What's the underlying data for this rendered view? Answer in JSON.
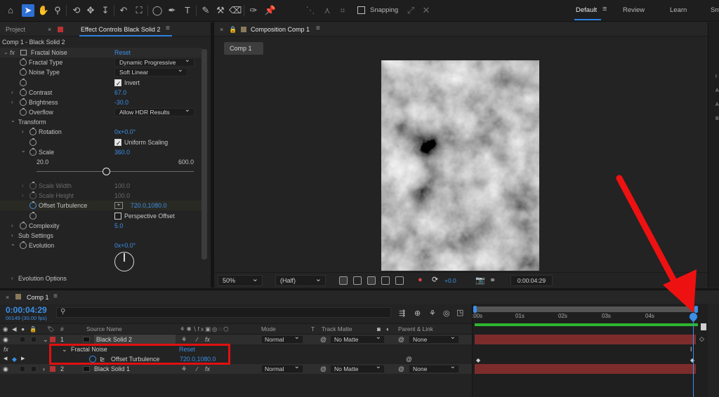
{
  "toolbar": {
    "snapping_label": "Snapping",
    "workspaces": [
      "Default",
      "Review",
      "Learn",
      "Sm"
    ],
    "active_workspace": "Default"
  },
  "project_tab": "Project",
  "effect_controls": {
    "tab_label": "Effect Controls Black Solid 2",
    "breadcrumb": "Comp 1 - Black Solid 2",
    "effect_name": "Fractal Noise",
    "reset": "Reset",
    "properties": {
      "fractal_type_label": "Fractal Type",
      "fractal_type_value": "Dynamic Progressive",
      "noise_type_label": "Noise Type",
      "noise_type_value": "Soft Linear",
      "invert_label": "Invert",
      "contrast_label": "Contrast",
      "contrast_value": "67.0",
      "brightness_label": "Brightness",
      "brightness_value": "-30.0",
      "overflow_label": "Overflow",
      "overflow_value": "Allow HDR Results",
      "transform_label": "Transform",
      "rotation_label": "Rotation",
      "rotation_value": "0x+0.0°",
      "uniform_scaling_label": "Uniform Scaling",
      "scale_label": "Scale",
      "scale_value": "360.0",
      "scale_min": "20.0",
      "scale_max": "600.0",
      "scale_slider_level": 0.44,
      "scale_width_label": "Scale Width",
      "scale_width_value": "100.0",
      "scale_height_label": "Scale Height",
      "scale_height_value": "100.0",
      "offset_turbulence_label": "Offset Turbulence",
      "offset_turbulence_value": "720.0,1080.0",
      "perspective_offset_label": "Perspective Offset",
      "complexity_label": "Complexity",
      "complexity_value": "5.0",
      "sub_settings_label": "Sub Settings",
      "evolution_label": "Evolution",
      "evolution_value": "0x+0.0°",
      "evolution_options_label": "Evolution Options"
    }
  },
  "composition": {
    "tab_label": "Composition Comp 1",
    "comp_button": "Comp 1",
    "zoom": "50%",
    "resolution": "(Half)",
    "exposure": "+0.0",
    "timecode": "0:00:04:29"
  },
  "timeline": {
    "tab_label": "Comp 1",
    "timecode": "0:00:04:29",
    "frame_info": "00149 (30.00 fps)",
    "search_placeholder": "",
    "columns": {
      "hash": "#",
      "source_name": "Source Name",
      "mode": "Mode",
      "t": "T",
      "track_matte": "Track Matte",
      "parent_link": "Parent & Link"
    },
    "ruler_labels": [
      ":00s",
      "01s",
      "02s",
      "03s",
      "04s"
    ],
    "layers": [
      {
        "num": "1",
        "name": "Black Solid 2",
        "mode": "Normal",
        "matte": "No Matte",
        "parent": "None"
      },
      {
        "num": "2",
        "name": "Black Solid 1",
        "mode": "Normal",
        "matte": "No Matte",
        "parent": "None"
      }
    ],
    "effect_row": {
      "name": "Fractal Noise",
      "reset": "Reset"
    },
    "property_row": {
      "name": "Offset Turbulence",
      "value": "720.0,1080.0"
    }
  },
  "colors": {
    "accent": "#3b8fe8",
    "highlight_box": "#e01010",
    "arrow": "#ee1111",
    "layer_bar": "#7d2c2c",
    "workarea_green": "#2fb52f"
  }
}
